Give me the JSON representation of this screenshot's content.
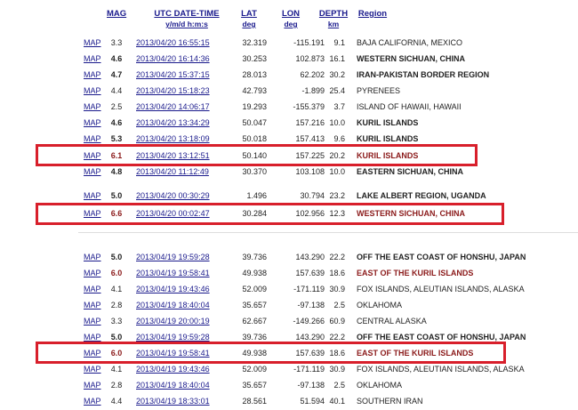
{
  "headers": {
    "mag": "MAG",
    "date": "UTC DATE-TIME",
    "date_sub": "y/m/d h:m:s",
    "lat": "LAT",
    "lat_sub": "deg",
    "lon": "LON",
    "lon_sub": "deg",
    "depth": "DEPTH",
    "depth_sub": "km",
    "region": "Region"
  },
  "map_label": "MAP",
  "rows": [
    {
      "mag": "3.3",
      "date": "2013/04/20 16:55:15",
      "lat": "32.319",
      "lon": "-115.191",
      "depth": "9.1",
      "region": "BAJA CALIFORNIA, MEXICO",
      "style": "normal"
    },
    {
      "mag": "4.6",
      "date": "2013/04/20 16:14:36",
      "lat": "30.253",
      "lon": "102.873",
      "depth": "16.1",
      "region": "WESTERN SICHUAN, CHINA",
      "style": "bold"
    },
    {
      "mag": "4.7",
      "date": "2013/04/20 15:37:15",
      "lat": "28.013",
      "lon": "62.202",
      "depth": "30.2",
      "region": "IRAN-PAKISTAN BORDER REGION",
      "style": "bold"
    },
    {
      "mag": "4.4",
      "date": "2013/04/20 15:18:23",
      "lat": "42.793",
      "lon": "-1.899",
      "depth": "25.4",
      "region": "PYRENEES",
      "style": "normal"
    },
    {
      "mag": "2.5",
      "date": "2013/04/20 14:06:17",
      "lat": "19.293",
      "lon": "-155.379",
      "depth": "3.7",
      "region": "ISLAND OF HAWAII, HAWAII",
      "style": "normal"
    },
    {
      "mag": "4.6",
      "date": "2013/04/20 13:34:29",
      "lat": "50.047",
      "lon": "157.216",
      "depth": "10.0",
      "region": "KURIL ISLANDS",
      "style": "bold"
    },
    {
      "mag": "5.3",
      "date": "2013/04/20 13:18:09",
      "lat": "50.018",
      "lon": "157.413",
      "depth": "9.6",
      "region": "KURIL ISLANDS",
      "style": "bold"
    },
    {
      "mag": "6.1",
      "date": "2013/04/20 13:12:51",
      "lat": "50.140",
      "lon": "157.225",
      "depth": "20.2",
      "region": "KURIL ISLANDS",
      "style": "red"
    },
    {
      "mag": "4.8",
      "date": "2013/04/20 11:12:49",
      "lat": "30.370",
      "lon": "103.108",
      "depth": "10.0",
      "region": "EASTERN SICHUAN, CHINA",
      "style": "bold"
    },
    {
      "mag": "5.0",
      "date": "2013/04/20 00:30:29",
      "lat": "1.496",
      "lon": "30.794",
      "depth": "23.2",
      "region": "LAKE ALBERT REGION, UGANDA",
      "style": "bold"
    },
    {
      "mag": "6.6",
      "date": "2013/04/20 00:02:47",
      "lat": "30.284",
      "lon": "102.956",
      "depth": "12.3",
      "region": "WESTERN SICHUAN, CHINA",
      "style": "red"
    },
    {
      "mag": "5.0",
      "date": "2013/04/19 19:59:28",
      "lat": "39.736",
      "lon": "143.290",
      "depth": "22.2",
      "region": "OFF THE EAST COAST OF HONSHU, JAPAN",
      "style": "bold"
    },
    {
      "mag": "6.0",
      "date": "2013/04/19 19:58:41",
      "lat": "49.938",
      "lon": "157.639",
      "depth": "18.6",
      "region": "EAST OF THE KURIL ISLANDS",
      "style": "red"
    },
    {
      "mag": "4.1",
      "date": "2013/04/19 19:43:46",
      "lat": "52.009",
      "lon": "-171.119",
      "depth": "30.9",
      "region": "FOX ISLANDS, ALEUTIAN ISLANDS, ALASKA",
      "style": "normal"
    },
    {
      "mag": "2.8",
      "date": "2013/04/19 18:40:04",
      "lat": "35.657",
      "lon": "-97.138",
      "depth": "2.5",
      "region": "OKLAHOMA",
      "style": "normal"
    },
    {
      "mag": "3.3",
      "date": "2013/04/19 20:00:19",
      "lat": "62.667",
      "lon": "-149.266",
      "depth": "60.9",
      "region": "CENTRAL ALASKA",
      "style": "normal"
    },
    {
      "mag": "5.0",
      "date": "2013/04/19 19:59:28",
      "lat": "39.736",
      "lon": "143.290",
      "depth": "22.2",
      "region": "OFF THE EAST COAST OF HONSHU, JAPAN",
      "style": "bold"
    },
    {
      "mag": "6.0",
      "date": "2013/04/19 19:58:41",
      "lat": "49.938",
      "lon": "157.639",
      "depth": "18.6",
      "region": "EAST OF THE KURIL ISLANDS",
      "style": "red"
    },
    {
      "mag": "4.1",
      "date": "2013/04/19 19:43:46",
      "lat": "52.009",
      "lon": "-171.119",
      "depth": "30.9",
      "region": "FOX ISLANDS, ALEUTIAN ISLANDS, ALASKA",
      "style": "normal"
    },
    {
      "mag": "2.8",
      "date": "2013/04/19 18:40:04",
      "lat": "35.657",
      "lon": "-97.138",
      "depth": "2.5",
      "region": "OKLAHOMA",
      "style": "normal"
    },
    {
      "mag": "4.4",
      "date": "2013/04/19 18:33:01",
      "lat": "28.561",
      "lon": "51.594",
      "depth": "40.1",
      "region": "SOUTHERN IRAN",
      "style": "normal"
    }
  ],
  "colors": {
    "link": "#1a1a8c",
    "highlight_text": "#8b1a1a",
    "highlight_box": "#d81f2b"
  }
}
